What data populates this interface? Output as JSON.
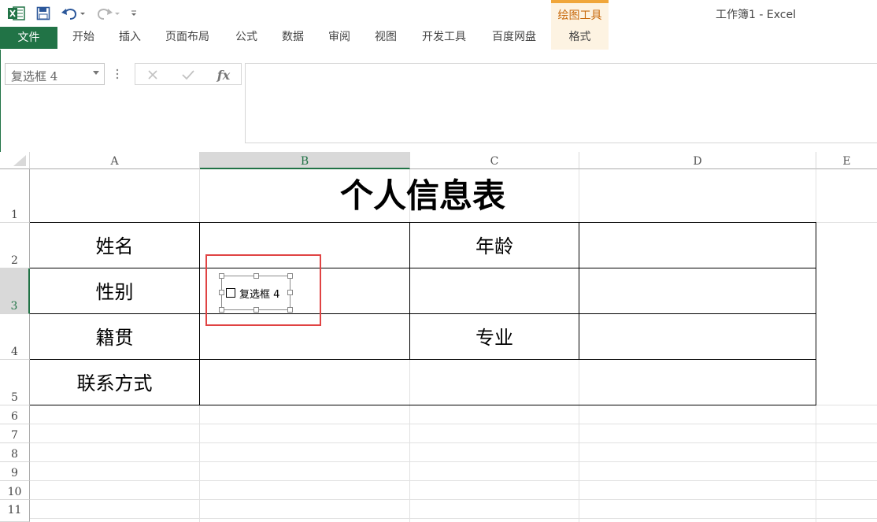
{
  "window": {
    "title": "工作簿1 - Excel"
  },
  "context_group": {
    "label": "绘图工具",
    "accent": "#f0a63a"
  },
  "tabs": [
    {
      "label": "文件"
    },
    {
      "label": "开始"
    },
    {
      "label": "插入"
    },
    {
      "label": "页面布局"
    },
    {
      "label": "公式"
    },
    {
      "label": "数据"
    },
    {
      "label": "审阅"
    },
    {
      "label": "视图"
    },
    {
      "label": "开发工具"
    },
    {
      "label": "百度网盘"
    },
    {
      "label": "格式"
    }
  ],
  "namebox": {
    "value": "复选框  4"
  },
  "formula_bar": {
    "content": "",
    "fx_label": "fx"
  },
  "columns": [
    "A",
    "B",
    "C",
    "D",
    "E"
  ],
  "active_column": "B",
  "rows": [
    "1",
    "2",
    "3",
    "4",
    "5",
    "6",
    "7",
    "8",
    "9",
    "10",
    "11"
  ],
  "active_row": "3",
  "sheet": {
    "title": "个人信息表",
    "name_label": "姓名",
    "age_label": "年龄",
    "gender_label": "性别",
    "native_label": "籍贯",
    "major_label": "专业",
    "contact_label": "联系方式"
  },
  "checkbox": {
    "label": "复选框 4",
    "checked": false
  },
  "colors": {
    "brand": "#217346",
    "highlight": "#e04343"
  }
}
